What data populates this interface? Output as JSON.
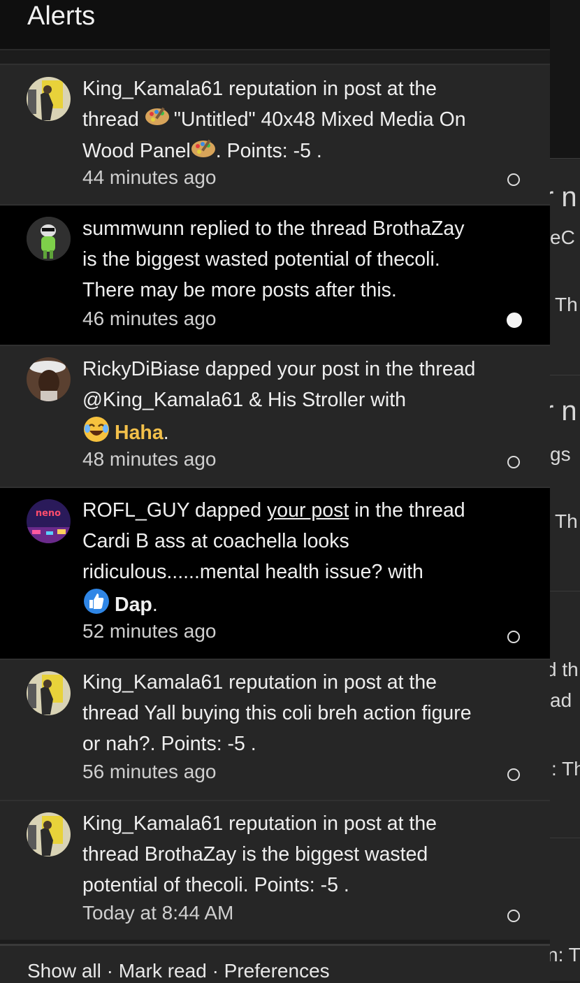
{
  "header": {
    "title": "Alerts"
  },
  "alerts": [
    {
      "user": "King_Kamala61",
      "line1": "King_Kamala61 reputation in post at the",
      "line2_pre": "thread ",
      "line2_post": "\"Untitled\" 40x48 Mixed Media On",
      "line3_pre": "Wood Panel",
      "line3_post": ". Points: -5 .",
      "time": "44 minutes ago",
      "status": "read"
    },
    {
      "user": "summwunn",
      "line1": "summwunn replied to the thread BrothaZay",
      "line2": "is the biggest wasted potential of thecoli.",
      "line3": "There may be more posts after this.",
      "time": "46 minutes ago",
      "status": "unread"
    },
    {
      "user": "RickyDiBiase",
      "line1": "RickyDiBiase dapped your post in the thread",
      "line2": "@King_Kamala61 & His Stroller with",
      "reaction": "Haha",
      "reaction_icon": "laughing-emoji-icon",
      "suffix": ".",
      "time": "48 minutes ago",
      "status": "read"
    },
    {
      "user": "ROFL_GUY",
      "line1_pre": "ROFL_GUY dapped ",
      "line1_link": "your post",
      "line1_post": " in the thread",
      "line2": "Cardi B ass at coachella looks",
      "line3": "ridiculous......mental health issue? with",
      "reaction": "Dap",
      "reaction_icon": "thumbs-up-icon",
      "suffix": ".",
      "time": "52 minutes ago",
      "status": "read",
      "avatar_text": "neno"
    },
    {
      "user": "King_Kamala61",
      "line1": "King_Kamala61 reputation in post at the",
      "line2": "thread Yall buying this coli breh action figure",
      "line3": "or nah?. Points: -5 .",
      "time": "56 minutes ago",
      "status": "read"
    },
    {
      "user": "King_Kamala61",
      "line1": "King_Kamala61 reputation in post at the",
      "line2": "thread BrothaZay is the biggest wasted",
      "line3": "potential of thecoli. Points: -5 .",
      "time": "Today at 8:44 AM",
      "status": "read"
    }
  ],
  "footer": {
    "show_all": "Show all",
    "mark_read": "Mark read",
    "preferences": "Preferences",
    "separator": "·"
  },
  "background_fragments": [
    "r n",
    "eC",
    "Th",
    "r n",
    "gs",
    "Th",
    "d th",
    "ad",
    ": Th",
    "n: T"
  ],
  "colors": {
    "unread_bg": "#000000",
    "read_bg": "#262626",
    "haha": "#f3c04a",
    "dap": "#2f86e6"
  }
}
